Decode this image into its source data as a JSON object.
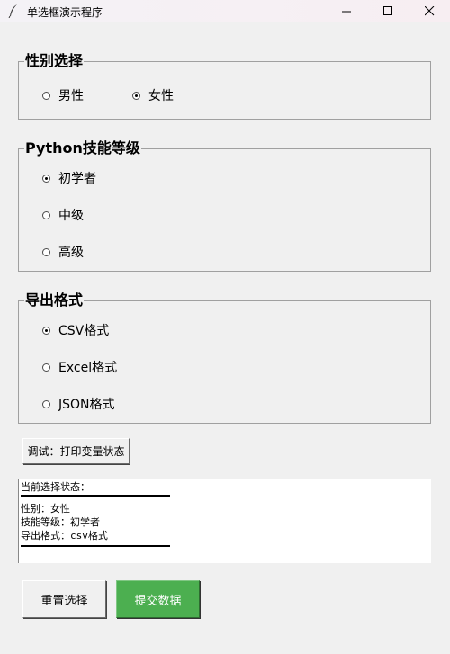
{
  "window": {
    "title": "单选框演示程序",
    "controls": [
      "minimize-icon",
      "maximize-icon",
      "close-icon"
    ]
  },
  "gender": {
    "legend": "性别选择",
    "options": [
      {
        "label": "男性",
        "selected": false
      },
      {
        "label": "女性",
        "selected": true
      }
    ]
  },
  "skill": {
    "legend": "Python技能等级",
    "options": [
      {
        "label": "初学者",
        "selected": true
      },
      {
        "label": "中级",
        "selected": false
      },
      {
        "label": "高级",
        "selected": false
      }
    ]
  },
  "export": {
    "legend": "导出格式",
    "options": [
      {
        "label": "CSV格式",
        "selected": true
      },
      {
        "label": "Excel格式",
        "selected": false
      },
      {
        "label": "JSON格式",
        "selected": false
      }
    ]
  },
  "debug_button": "调试：打印变量状态",
  "status": {
    "header": "当前选择状态：",
    "lines": [
      "性别：女性",
      "技能等级：初学者",
      "导出格式：csv格式"
    ]
  },
  "buttons": {
    "reset": "重置选择",
    "submit": "提交数据"
  },
  "colors": {
    "submit_bg": "#4caf50",
    "window_bg": "#f0f0f0"
  }
}
